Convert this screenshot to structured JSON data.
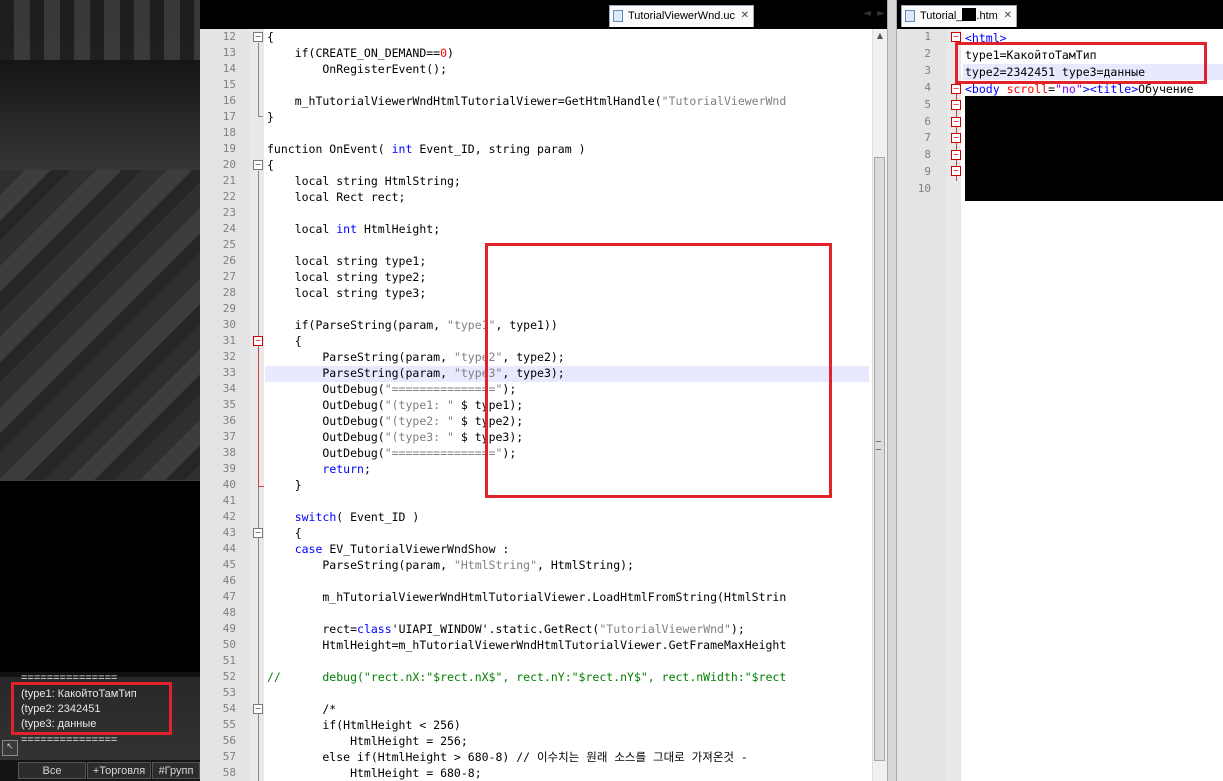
{
  "game": {
    "chat_lines": [
      "===============",
      "(type1: КакойтоТамТип",
      "(type2: 2342451",
      "(type3: данные",
      "==============="
    ],
    "chat_tabs": [
      "Все",
      "+Торговля",
      "#Групп"
    ],
    "toggle_icon": "arrow-toggle-icon"
  },
  "editor_left": {
    "tab_label": "TutorialViewerWnd.uc",
    "nav_left": "◄",
    "nav_right": "►",
    "line_numbers": [
      "12",
      "13",
      "14",
      "15",
      "16",
      "17",
      "18",
      "19",
      "20",
      "21",
      "22",
      "23",
      "24",
      "25",
      "26",
      "27",
      "28",
      "29",
      "30",
      "31",
      "32",
      "33",
      "34",
      "35",
      "36",
      "37",
      "38",
      "39",
      "40",
      "41",
      "42",
      "43",
      "44",
      "45",
      "46",
      "47",
      "48",
      "49",
      "50",
      "51",
      "52",
      "53",
      "54",
      "55",
      "56",
      "57",
      "58"
    ],
    "lines": [
      "{",
      "    if(CREATE_ON_DEMAND==0)",
      "        OnRegisterEvent();",
      "",
      "    m_hTutorialViewerWndHtmlTutorialViewer=GetHtmlHandle(\"TutorialViewerWnd",
      "}",
      "",
      "function OnEvent( int Event_ID, string param )",
      "{",
      "    local string HtmlString;",
      "    local Rect rect;",
      "",
      "    local int HtmlHeight;",
      "",
      "    local string type1;",
      "    local string type2;",
      "    local string type3;",
      "",
      "    if(ParseString(param, \"type1\", type1))",
      "    {",
      "        ParseString(param, \"type2\", type2);",
      "        ParseString(param, \"type3\", type3);",
      "        OutDebug(\"===============\");",
      "        OutDebug(\"(type1: \" $ type1);",
      "        OutDebug(\"(type2: \" $ type2);",
      "        OutDebug(\"(type3: \" $ type3);",
      "        OutDebug(\"===============\");",
      "        return;",
      "    }",
      "",
      "    switch( Event_ID )",
      "    {",
      "    case EV_TutorialViewerWndShow :",
      "        ParseString(param, \"HtmlString\", HtmlString);",
      "",
      "        m_hTutorialViewerWndHtmlTutorialViewer.LoadHtmlFromString(HtmlStrin",
      "",
      "        rect=class'UIAPI_WINDOW'.static.GetRect(\"TutorialViewerWnd\");",
      "        HtmlHeight=m_hTutorialViewerWndHtmlTutorialViewer.GetFrameMaxHeight",
      "",
      "//      debug(\"rect.nX:\"$rect.nX$\", rect.nY:\"$rect.nY$\", rect.nWidth:\"$rect",
      "",
      "        /*",
      "        if(HtmlHeight < 256)",
      "            HtmlHeight = 256;",
      "        else if(HtmlHeight > 680-8) // 이수치는 원래 소스를 그대로 가져온것 -",
      "            HtmlHeight = 680-8;"
    ]
  },
  "editor_right": {
    "tab_label": "Tutorial_",
    "tab_suffix": ".htm",
    "line_numbers": [
      "1",
      "2",
      "3",
      "4",
      "5",
      "6",
      "7",
      "8",
      "9",
      "10"
    ],
    "lines": [
      "<html>",
      "type1=КакойтоТамТип",
      "type2=2342451 type3=данные",
      "<body scroll=\"no\"><title>Обучение"
    ]
  }
}
